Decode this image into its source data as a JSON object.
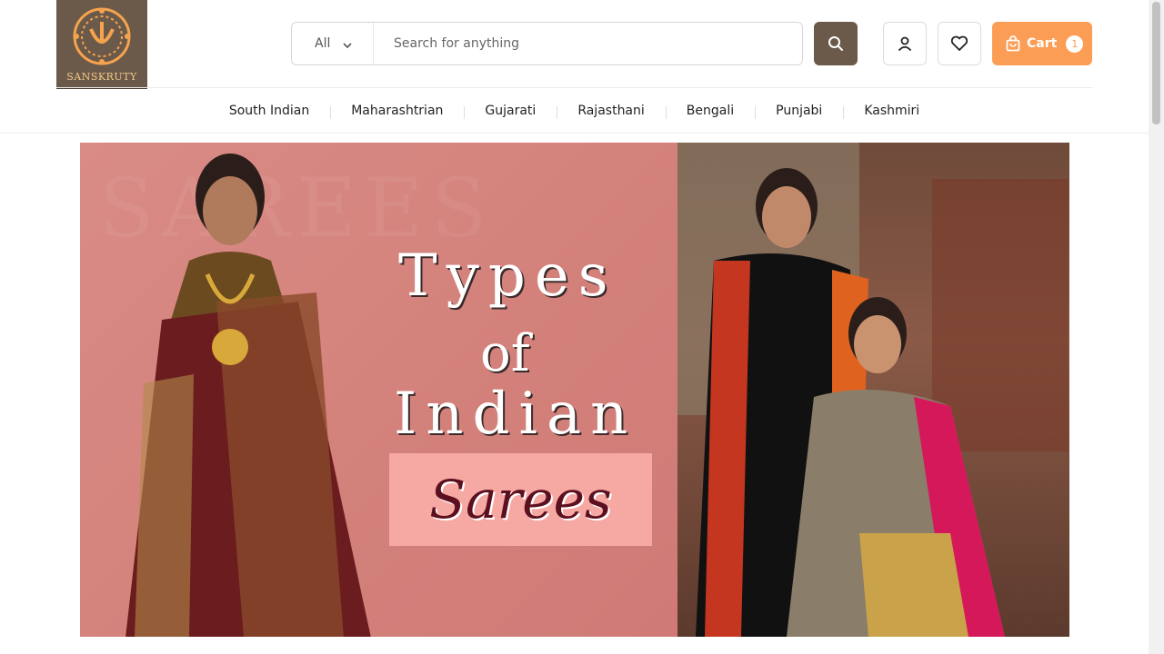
{
  "logo": {
    "text": "SANSKRUTY"
  },
  "search": {
    "category": "All",
    "placeholder": "Search for anything"
  },
  "cart": {
    "label": "Cart",
    "count": "1"
  },
  "nav": {
    "items": [
      "South Indian",
      "Maharashtrian",
      "Gujarati",
      "Rajasthani",
      "Bengali",
      "Punjabi",
      "Kashmiri"
    ]
  },
  "banner": {
    "line1": "Types",
    "line2": "of",
    "line3": "Indian",
    "line4": "Sarees",
    "watermark": "SAREES"
  },
  "colors": {
    "brand": "#6b5a4a",
    "accent": "#fb9d55",
    "banner_pink": "#d98b85"
  },
  "icons": [
    "search-icon",
    "user-icon",
    "heart-icon",
    "shopping-bag-icon",
    "chevron-down-icon"
  ]
}
